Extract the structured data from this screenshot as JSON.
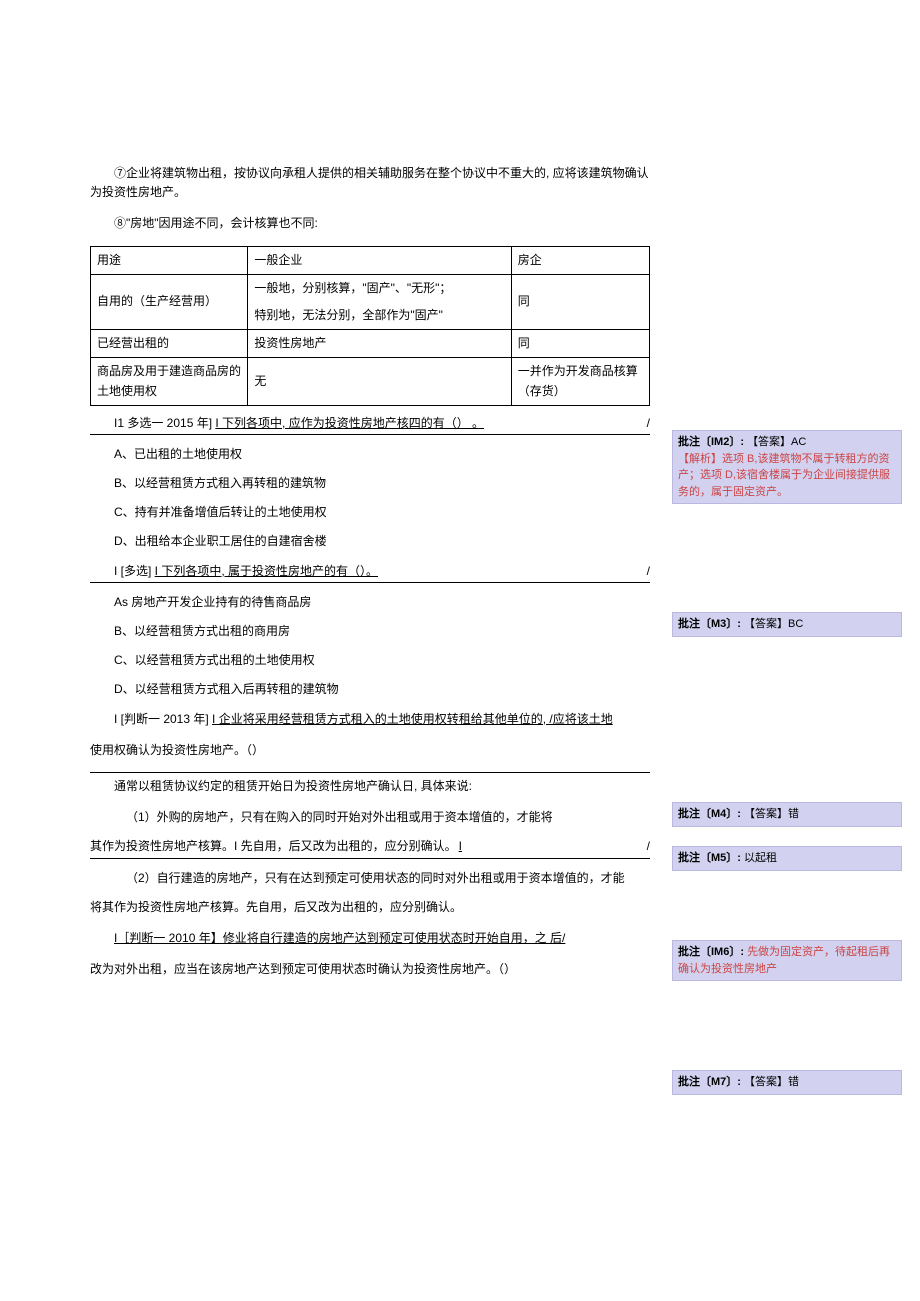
{
  "para7": "⑦企业将建筑物出租，按协议向承租人提供的相关辅助服务在整个协议中不重大的, 应将该建筑物确认为投资性房地产。",
  "para8": "⑧\"房地\"因用途不同，会计核算也不同:",
  "table": {
    "h1": "用途",
    "h2": "一般企业",
    "h3": "房企",
    "r1c1": "自用的（生产经营用）",
    "r1c2a": "一般地，分别核算，\"固产\"、\"无形\"；",
    "r1c2b": "特别地，无法分别，全部作为\"固产\"",
    "r1c3": "同",
    "r2c1": "已经营出租的",
    "r2c2": "投资性房地产",
    "r2c3": "同",
    "r3c1": "商品房及用于建造商品房的土地使用权",
    "r3c2": "无",
    "r3c3": "一并作为开发商品核算（存货）"
  },
  "q1": {
    "stem_a": "I1 多选一 2015 年] ",
    "stem_b": "I 下列各项中,  应作为投资性房地产核四的有（） 。",
    "optA": "A、已出租的土地使用权",
    "optB": "B、以经营租赁方式租入再转租的建筑物",
    "optC": "C、持有并准备增值后转让的土地使用权",
    "optD": "D、出租给本企业职工居住的自建宿舍楼"
  },
  "q2": {
    "stem_a": "I [多选] ",
    "stem_b": "I 下列各项中,  属于投资性房地产的有（）。",
    "optA": "As 房地产开发企业持有的待售商品房",
    "optB": "B、以经营租赁方式出租的商用房",
    "optC": "C、以经营租赁方式出租的土地使用权",
    "optD": "D、以经营租赁方式租入后再转租的建筑物"
  },
  "q3": {
    "stem_a": "I [判断一 2013 年] ",
    "stem_b": "I 企业将采用经营租赁方式租入的土地使用权转租给其他单位的, /应将该土地",
    "tail": "使用权确认为投资性房地产。（）"
  },
  "paraC": "通常以租赁协议约定的租赁开始日为投资性房地产确认日, 具体来说:",
  "paraC1": "（1）外购的房地产，只有在购入的同时开始对外出租或用于资本增值的，才能将",
  "paraC1b_a": "其作为投资性房地产核算。I 先自用，后又改为出租的，应分别确认。",
  "paraC1b_b": "I",
  "paraC2": "（2）自行建造的房地产，只有在达到预定可使用状态的同时对外出租或用于资本增值的，才能",
  "paraC2b": "将其作为投资性房地产核算。先自用，后又改为出租的，应分别确认。",
  "q4": {
    "stem": "I［判断一 2010 年】修业将自行建造的房地产达到预定可使用状态时开始自用，之 后/",
    "tail": "改为对外出租，应当在该房地产达到预定可使用状态时确认为投资性房地产。（）"
  },
  "comments": {
    "m2": {
      "label": "批注〔IM2〕:",
      "answer": "【答案】AC",
      "body": "【解析】选项 B,该建筑物不属于转租方的资产；选项 D,该宿舍楼属于为企业间接提供服务的，属于固定资产。"
    },
    "m3": {
      "label": "批注〔M3〕:",
      "answer": "【答案】BC"
    },
    "m4": {
      "label": "批注〔M4〕:",
      "answer": "【答案】错"
    },
    "m5": {
      "label": "批注〔M5〕:",
      "body": "以起租"
    },
    "m6": {
      "label": "批注〔IM6〕:",
      "body": "先做为固定资产，待起租后再确认为投资性房地产"
    },
    "m7": {
      "label": "批注〔M7〕:",
      "answer": "【答案】错"
    }
  }
}
